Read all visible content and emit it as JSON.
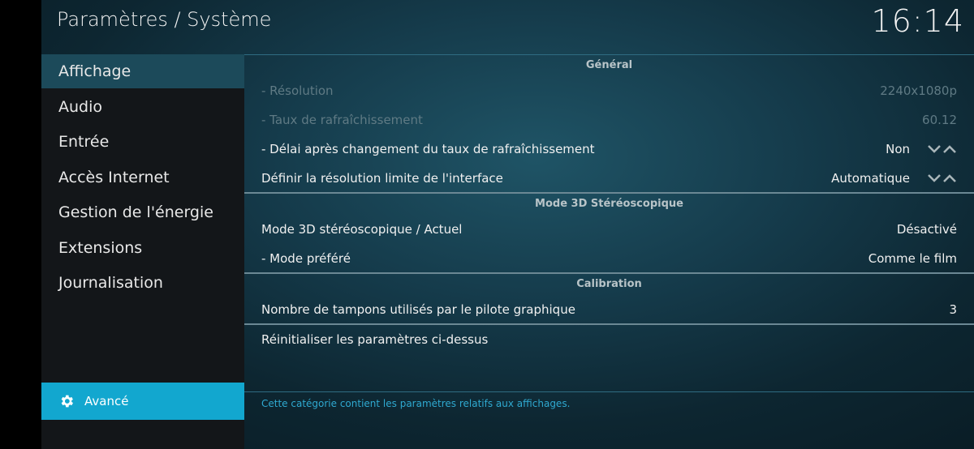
{
  "header": {
    "title": "Paramètres / Système",
    "clock": "16:14"
  },
  "sidebar": {
    "items": [
      {
        "label": "Affichage"
      },
      {
        "label": "Audio"
      },
      {
        "label": "Entrée"
      },
      {
        "label": "Accès Internet"
      },
      {
        "label": "Gestion de l'énergie"
      },
      {
        "label": "Extensions"
      },
      {
        "label": "Journalisation"
      }
    ],
    "advanced_label": "Avancé"
  },
  "sections": {
    "general": {
      "title": "Général",
      "rows": [
        {
          "label": "- Résolution",
          "value": "2240x1080p"
        },
        {
          "label": "- Taux de rafraîchissement",
          "value": "60.12"
        },
        {
          "label": "- Délai après changement du taux de rafraîchissement",
          "value": "Non"
        },
        {
          "label": "Définir la résolution limite de l'interface",
          "value": "Automatique"
        }
      ]
    },
    "stereo": {
      "title": "Mode 3D Stéréoscopique",
      "rows": [
        {
          "label": "Mode 3D stéréoscopique / Actuel",
          "value": "Désactivé"
        },
        {
          "label": "- Mode préféré",
          "value": "Comme le film"
        }
      ]
    },
    "calibration": {
      "title": "Calibration",
      "rows": [
        {
          "label": "Nombre de tampons utilisés par le pilote graphique",
          "value": "3"
        }
      ]
    }
  },
  "reset_label": "Réinitialiser les paramètres ci-dessus",
  "description": "Cette catégorie contient les paramètres relatifs aux affichages.",
  "colors": {
    "accent": "#12a7cf",
    "active_item": "#1c4a5a",
    "disabled_text": "#5f7a84"
  }
}
